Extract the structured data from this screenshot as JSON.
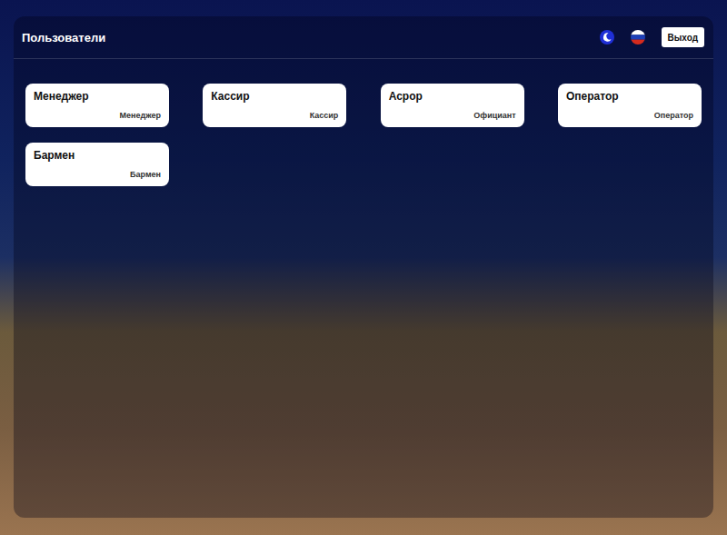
{
  "window": {
    "title": "Пользователи"
  },
  "header": {
    "logout_button": "Выход"
  },
  "users": [
    {
      "name": "Менеджер",
      "role": "Менеджер"
    },
    {
      "name": "Кассир",
      "role": "Кассир"
    },
    {
      "name": "Асрор",
      "role": "Официант"
    },
    {
      "name": "Оператор",
      "role": "Оператор"
    },
    {
      "name": "Бармен",
      "role": "Бармен"
    }
  ]
}
